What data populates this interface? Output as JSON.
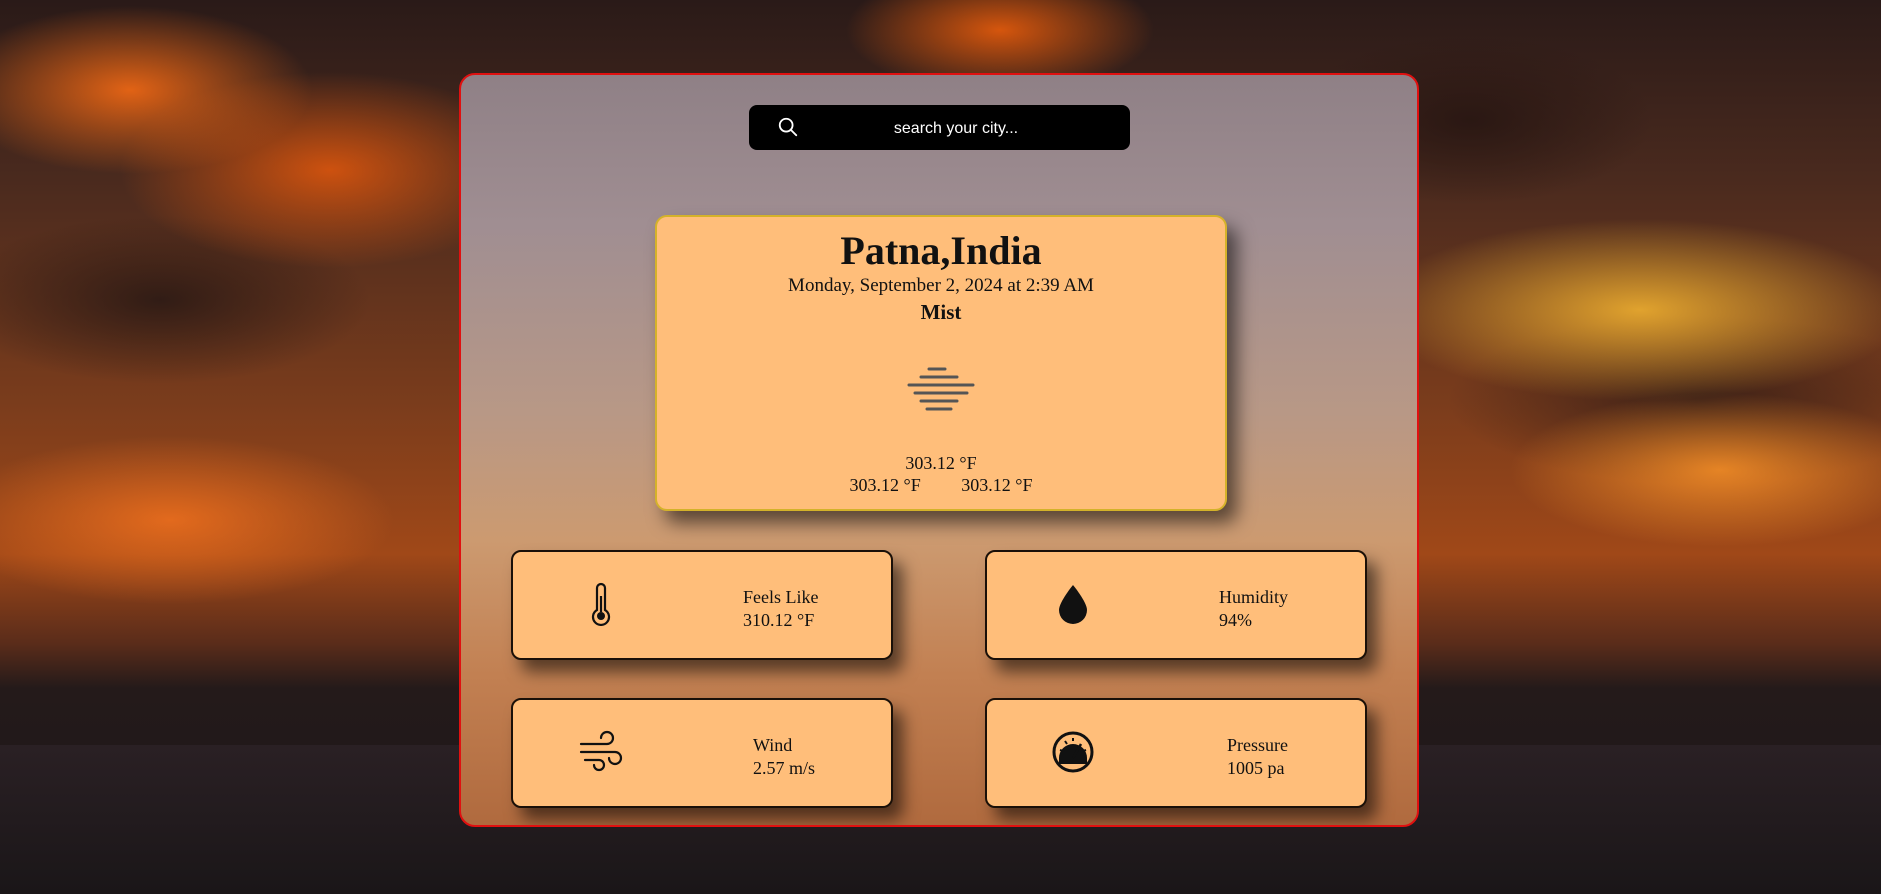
{
  "search": {
    "placeholder": "search your city...",
    "icon": "search-icon"
  },
  "weather": {
    "city": "Patna,India",
    "datetime": "Monday, September 2, 2024 at 2:39 AM",
    "condition": "Mist",
    "condition_icon": "mist-icon",
    "temperature": "303.12 °F",
    "temp_min": "303.12 °F",
    "temp_max": "303.12 °F"
  },
  "stats": {
    "feels_like": {
      "label": "Feels Like",
      "value": "310.12 °F",
      "icon": "thermometer-icon"
    },
    "humidity": {
      "label": "Humidity",
      "value": "94%",
      "icon": "water-drop-icon"
    },
    "wind": {
      "label": "Wind",
      "value": "2.57 m/s",
      "icon": "wind-icon"
    },
    "pressure": {
      "label": "Pressure",
      "value": "1005 pa",
      "icon": "gauge-icon"
    }
  },
  "colors": {
    "card_bg": "#ffbe7a",
    "panel_border": "#e01010",
    "main_card_border": "#d4b22a",
    "search_bg": "#000000"
  }
}
